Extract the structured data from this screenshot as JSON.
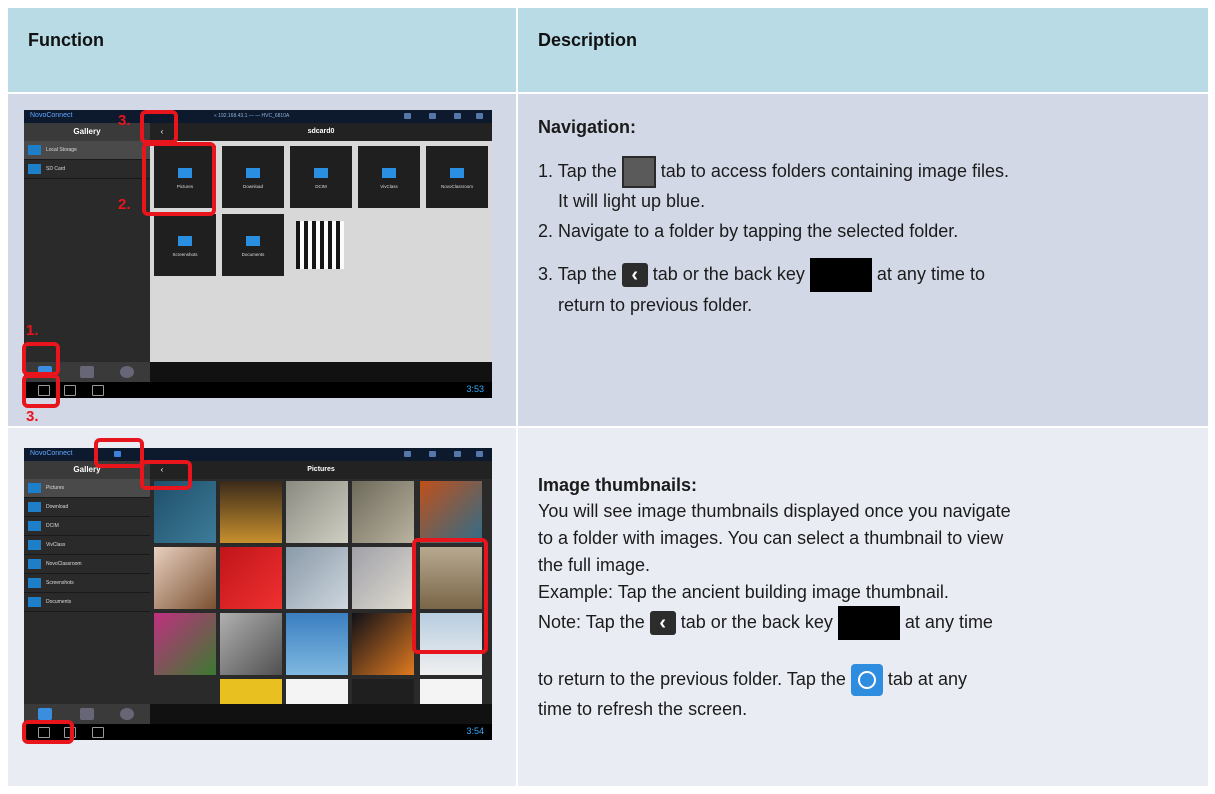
{
  "header": {
    "function": "Function",
    "description": "Description"
  },
  "row1": {
    "shot": {
      "app_title": "NovoConnect",
      "status_text": "« 192.168.43.1 — — HVC_6810A",
      "gallery": "Gallery",
      "path": "sdcard0",
      "sidebar": [
        "Local Storage",
        "SD Card"
      ],
      "folders": [
        "Pictures",
        "Download",
        "DCIM",
        "VivClass",
        "NovoClassroom",
        "Screenshots",
        "Documents"
      ],
      "clock": "3:53",
      "markers": [
        "3.",
        "2.",
        "1.",
        "3."
      ]
    },
    "title": "Navigation:",
    "steps": [
      {
        "n": "1.",
        "pre": "Tap the",
        "post": "tab to access folders containing image files.",
        "cont": "It will light up blue."
      },
      {
        "n": "2.",
        "text": "Navigate to a folder by tapping the selected folder."
      },
      {
        "n": "3.",
        "pre": "Tap the",
        "mid": "tab or the back key",
        "post": "at any time to",
        "cont": "return to previous folder."
      }
    ]
  },
  "row2": {
    "shot": {
      "app_title": "NovoConnect",
      "gallery": "Gallery",
      "path": "Pictures",
      "sidebar": [
        "Pictures",
        "Download",
        "DCIM",
        "VivClass",
        "NovoClassroom",
        "Screenshots",
        "Documents"
      ],
      "clock": "3:54"
    },
    "title": "Image thumbnails:",
    "lines": [
      "You will see image thumbnails displayed once you navigate",
      "to a folder with images. You can select a thumbnail to view",
      "the full image.",
      "Example: Tap the ancient building image thumbnail."
    ],
    "note_pre": "Note: Tap the",
    "note_mid": "tab or the back key",
    "note_post": "at any time",
    "note2_pre": "to return to the previous folder. Tap the",
    "note2_post": "tab at any",
    "note3": "time to refresh the screen."
  },
  "colors": {
    "header_bg": "#b9dbe6",
    "row1_bg": "#d3d8e6",
    "row2_bg": "#e9ecf3",
    "marker": "#e8151c"
  }
}
